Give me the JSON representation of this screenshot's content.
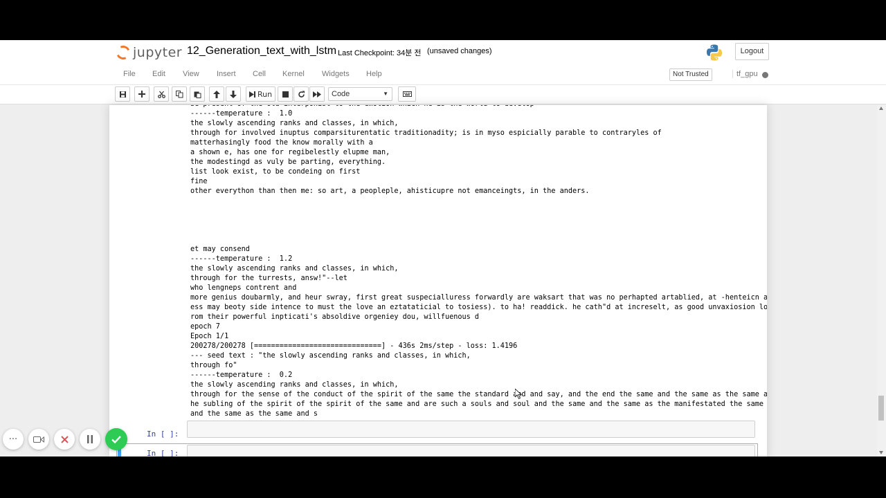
{
  "header": {
    "logo_text": "jupyter",
    "notebook_name": "12_Generation_text_with_lstm",
    "checkpoint": "Last Checkpoint: 34분 전",
    "unsaved": "(unsaved changes)",
    "logout_label": "Logout"
  },
  "menu": {
    "items": [
      "File",
      "Edit",
      "View",
      "Insert",
      "Cell",
      "Kernel",
      "Widgets",
      "Help"
    ],
    "trust_label": "Not Trusted",
    "kernel_name": "tf_gpu"
  },
  "toolbar": {
    "run_label": "Run",
    "cell_type": "Code"
  },
  "output": {
    "lines": [
      "be present of the old interponist to the emotion which he is the world to develop",
      "------temperature :  1.0",
      "the slowly ascending ranks and classes, in which,",
      "through for involved inuptus comparsiturentatic traditionadity; is in myso espicially parable to contraryles of",
      "matterhasingly food the know morally with a",
      "a shown e, has one for regibelestly elupme man,",
      "the modestingd as vuly be parting, everything.",
      "list look exist, to be condeing on first",
      "fine",
      "other everython than then me: so art, a peopleple, ahisticupre not emanceingts, in the anders.",
      "",
      "",
      "",
      "",
      "",
      "et may consend",
      "------temperature :  1.2",
      "the slowly ascending ranks and classes, in which,",
      "through for the turrests, answ!\"--let",
      "who lengneps contrent and",
      "more genius doubarmly, and heur swray, first great suspecialluress forwardly are waksart that was no perhapted artablied, at -henteicn addr",
      "ess may beoty side intence to must the love an eztataticial to tosiess). to ha! readdick. he cath\"d at increselt, as good unvaxiosion low f",
      "rom their powerful inpticati's absoldive orgeniey dou, willfuenous d",
      "epoch 7",
      "Epoch 1/1",
      "200278/200278 [==============================] - 436s 2ms/step - loss: 1.4196",
      "--- seed text : \"the slowly ascending ranks and classes, in which,",
      "through fo\"",
      "------temperature :  0.2",
      "the slowly ascending ranks and classes, in which,",
      "through for the sense of the conduct of the spirit of the same the standard and and say, and the end the same and the same as the same as t",
      "he subling of the spirit of the spirit of the same and are such a souls and soul and the same and the same as the manifestated the same and",
      "and the same as the same and s"
    ]
  },
  "cells": {
    "prompt1": "In [ ]:",
    "prompt2": "In [ ]:"
  },
  "colors": {
    "kernel_idle": "#777777",
    "prompt": "#303f9f",
    "confirm_button": "#2ecc55"
  }
}
